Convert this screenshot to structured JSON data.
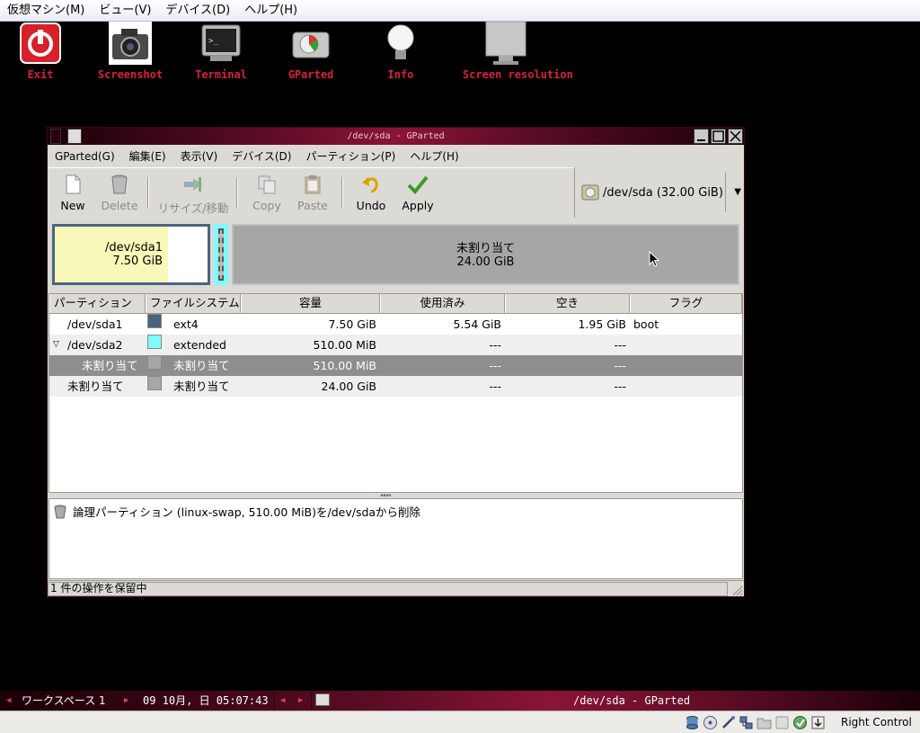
{
  "vbox_menu": [
    "仮想マシン(M)",
    "ビュー(V)",
    "デバイス(D)",
    "ヘルプ(H)"
  ],
  "desktop_icons": {
    "exit": "Exit",
    "screenshot": "Screenshot",
    "terminal": "Terminal",
    "gparted": "GParted",
    "info": "Info",
    "screen_resolution": "Screen resolution"
  },
  "window": {
    "title": "/dev/sda - GParted",
    "menu": [
      "GParted(G)",
      "編集(E)",
      "表示(V)",
      "デバイス(D)",
      "パーティション(P)",
      "ヘルプ(H)"
    ],
    "toolbar": {
      "new": "New",
      "delete": "Delete",
      "resize": "リサイズ/移動",
      "copy": "Copy",
      "paste": "Paste",
      "undo": "Undo",
      "apply": "Apply"
    },
    "device": "/dev/sda  (32.00 GiB)",
    "map": {
      "sda1_name": "/dev/sda1",
      "sda1_size": "7.50 GiB",
      "unalloc_name": "未割り当て",
      "unalloc_size": "24.00 GiB"
    },
    "table": {
      "headers": [
        "パーティション",
        "ファイルシステム",
        "容量",
        "使用済み",
        "空き",
        "フラグ"
      ],
      "rows": [
        {
          "partition": "/dev/sda1",
          "fs": "ext4",
          "size": "7.50 GiB",
          "used": "5.54 GiB",
          "free": "1.95 GiB",
          "flags": "boot",
          "color": "#4a6480"
        },
        {
          "partition": "/dev/sda2",
          "fs": "extended",
          "size": "510.00 MiB",
          "used": "---",
          "free": "---",
          "flags": "",
          "color": "#7efcfc"
        },
        {
          "partition": "未割り当て",
          "fs": "未割り当て",
          "size": "510.00 MiB",
          "used": "---",
          "free": "---",
          "flags": "",
          "color": "#a6a6a6"
        },
        {
          "partition": "未割り当て",
          "fs": "未割り当て",
          "size": "24.00 GiB",
          "used": "---",
          "free": "---",
          "flags": "",
          "color": "#a6a6a6"
        }
      ]
    },
    "pending_op": "論理パーティション (linux-swap, 510.00 MiB)を/dev/sdaから削除",
    "status": "1 件の操作を保留中"
  },
  "taskbar": {
    "workspace": "ワークスペース 1",
    "clock": "09 10月, 日 05:07:43",
    "task": "/dev/sda - GParted"
  },
  "vbox_status": {
    "host_key": "Right Control"
  },
  "colors": {
    "sda1": "#4a6480",
    "extended": "#7efcfc",
    "unallocated": "#a6a6a6",
    "sda1_used": "#f8f8b8",
    "title_accent": "#8a1436",
    "desktop_label": "#d8203a"
  }
}
